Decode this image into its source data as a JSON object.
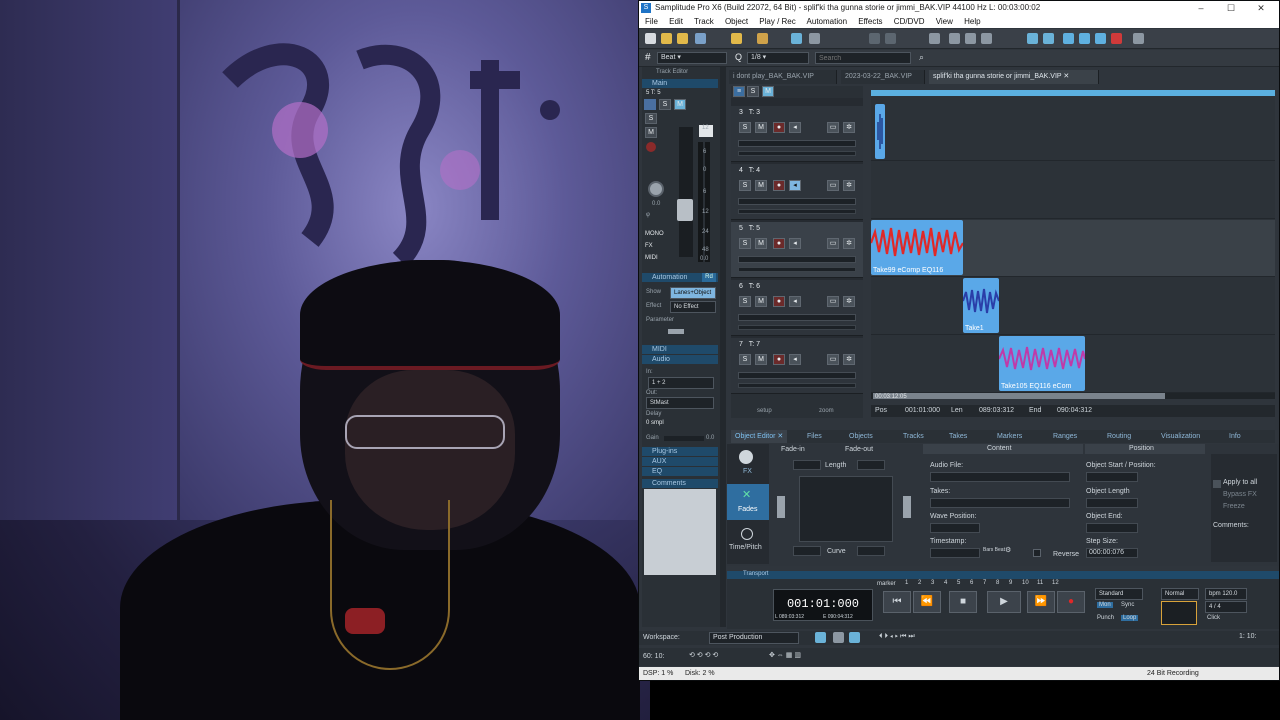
{
  "window": {
    "title": "Samplitude Pro X6 (Build 22072, 64 Bit)  -  splif'ki tha gunna storie or jimmi_BAK.VIP   44100 Hz L: 00:03:00:02",
    "app_icon": "S"
  },
  "menu": [
    "File",
    "Edit",
    "Track",
    "Object",
    "Play / Rec",
    "Automation",
    "Effects",
    "CD/DVD",
    "View",
    "Help"
  ],
  "toolbar": {
    "grid_label": "Beat",
    "quantize": "1/8",
    "search_placeholder": "Search"
  },
  "file_tabs": [
    {
      "label": "i dont play_BAK_BAK.VIP",
      "active": false
    },
    {
      "label": "2023-03-22_BAK.VIP",
      "active": false
    },
    {
      "label": "splif'ki tha gunna storie or jimmi_BAK.VIP",
      "active": true
    }
  ],
  "inspector": {
    "track_editor_label": "Track Editor",
    "main_label": "Main",
    "track_label": "5   T: 5",
    "s": "S",
    "m": "M",
    "meter_marks": [
      "12",
      "6",
      "0",
      "6",
      "12",
      "24",
      "48"
    ],
    "pan_value": "0.0",
    "fader_value": "0.0",
    "mono": "MONO",
    "fx": "FX",
    "midi": "MIDI",
    "automation_label": "Automation",
    "rd": "Rd",
    "show_label": "Show",
    "show_value": "Lanes+Object",
    "effect_label": "Effect",
    "effect_value": "No Effect",
    "parameter_label": "Parameter",
    "midi_section": "MIDI",
    "audio_section": "Audio",
    "in_label": "In:",
    "in_value": "1 + 2",
    "out_label": "Out:",
    "out_value": "StMast",
    "delay_label": "Delay",
    "delay_value": "0 smpl",
    "gain_label": "Gain",
    "gain_value": "0.0",
    "plugins": "Plug-ins",
    "aux": "AUX",
    "eq": "EQ",
    "comments": "Comments"
  },
  "tracks": [
    {
      "num": "3",
      "name": "T: 3",
      "selected": false
    },
    {
      "num": "4",
      "name": "T: 4",
      "selected": false
    },
    {
      "num": "5",
      "name": "T: 5",
      "selected": true
    },
    {
      "num": "6",
      "name": "T: 6",
      "selected": false
    },
    {
      "num": "7",
      "name": "T: 7",
      "selected": false
    }
  ],
  "track_buttons": {
    "s": "S",
    "m": "M"
  },
  "tracklist_footer": {
    "setup": "setup",
    "zoom": "zoom"
  },
  "clips": [
    {
      "track": "3",
      "name": ""
    },
    {
      "track": "5",
      "name": "Take99   eComp EQ116"
    },
    {
      "track": "6",
      "name": "Take1"
    },
    {
      "track": "7",
      "name": "Take105   EQ116 eCom"
    }
  ],
  "arrange_time": "00:03:12:05",
  "position_bar": {
    "pos_label": "Pos",
    "pos": "001:01:000",
    "len_label": "Len",
    "len": "089:03:312",
    "end_label": "End",
    "end": "090:04:312"
  },
  "object_editor_tabs": [
    "Object Editor",
    "Files",
    "Objects",
    "Tracks",
    "Takes",
    "Markers",
    "Ranges",
    "Routing",
    "Visualization",
    "Info"
  ],
  "object_editor": {
    "side": [
      "FX",
      "Fades",
      "Time/Pitch"
    ],
    "fade_in": "Fade-in",
    "fade_out": "Fade-out",
    "length": "Length",
    "curve": "Curve",
    "content_header": "Content",
    "position_header": "Position",
    "audio_file": "Audio File:",
    "takes": "Takes:",
    "wave_position": "Wave Position:",
    "timestamp": "Timestamp:",
    "bars_beat": "Bars Beat",
    "reverse": "Reverse",
    "object_start": "Object Start / Position:",
    "object_length": "Object Length",
    "object_end": "Object End:",
    "step_size": "Step Size:",
    "step_value": "000:00:076",
    "apply_to_all": "Apply to all",
    "bypass_fx": "Bypass FX",
    "freeze": "Freeze",
    "comments": "Comments:"
  },
  "transport": {
    "label": "Transport",
    "timecode": "001:01:000",
    "sub_l": "L  089:03:312",
    "sub_e": "E  090:04:312",
    "marker_label": "marker",
    "markers": [
      "1",
      "2",
      "3",
      "4",
      "5",
      "6",
      "7",
      "8",
      "9",
      "10",
      "11",
      "12"
    ],
    "mode": "Standard",
    "mon": "Mon",
    "sync": "Sync",
    "punch": "Punch",
    "loop": "Loop",
    "normal": "Normal",
    "bpm": "bpm  120.0",
    "signature": "4 / 4",
    "click": "Click"
  },
  "workspace": {
    "label": "Workspace:",
    "value": "Post Production"
  },
  "bottom_left": "60: 10:",
  "bottom_right": "1: 10:",
  "status": {
    "dsp": "DSP: 1 %",
    "disk": "Disk:   2 %",
    "recording": "24 Bit Recording"
  }
}
